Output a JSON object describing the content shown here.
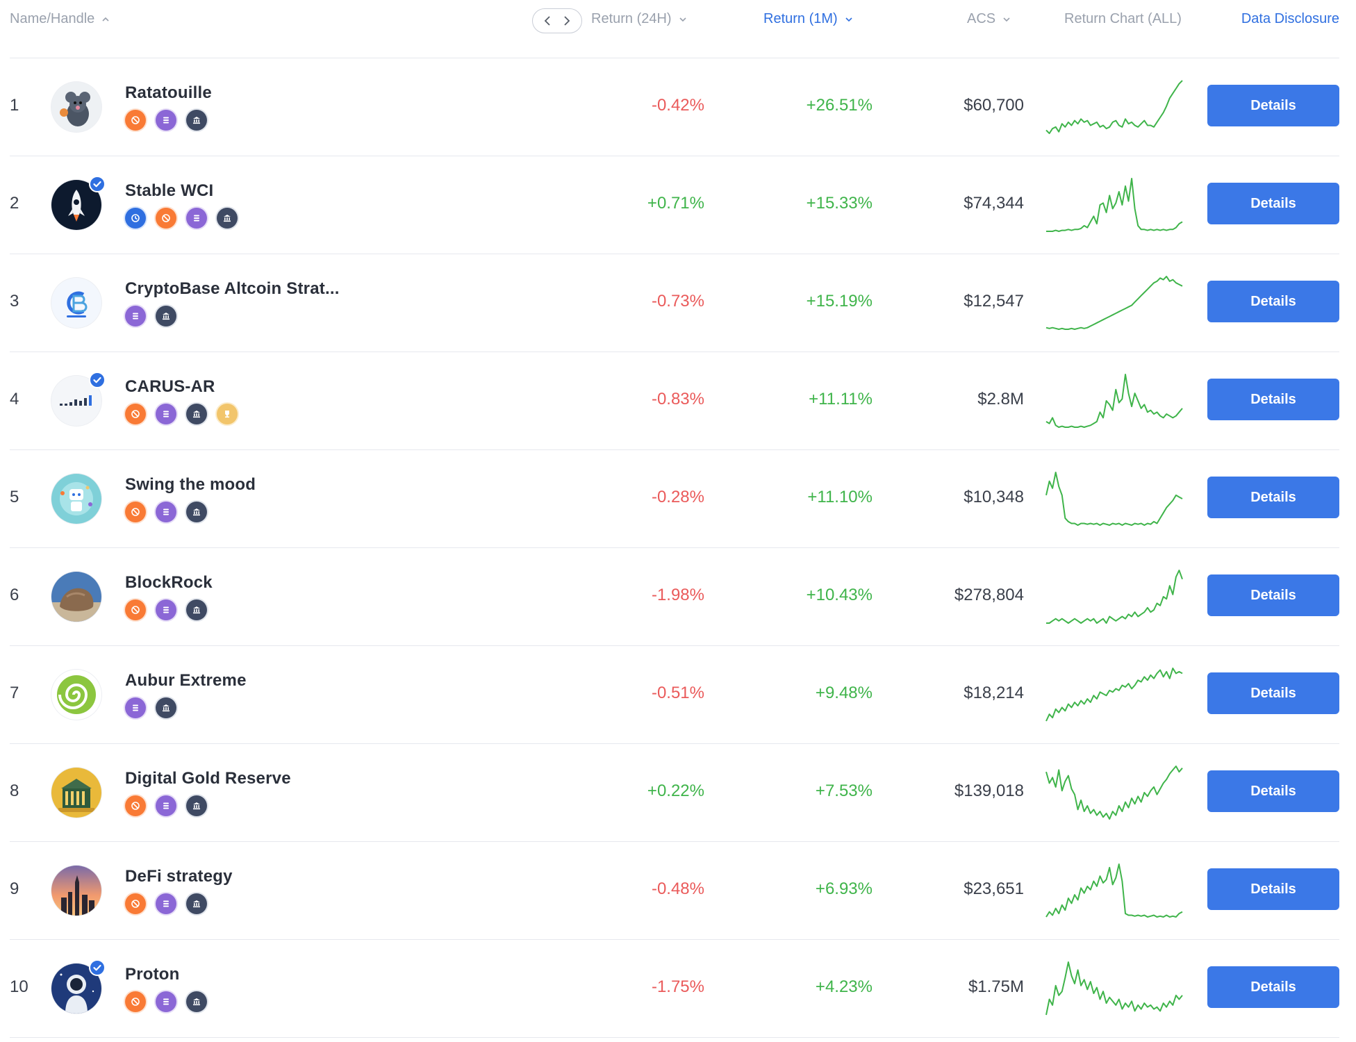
{
  "header": {
    "name_handle": "Name/Handle",
    "return_24h": "Return (24H)",
    "return_1m": "Return (1M)",
    "acs": "ACS",
    "return_chart": "Return Chart (ALL)",
    "data_disclosure": "Data Disclosure"
  },
  "details_label": "Details",
  "colors": {
    "negative": "#ea5a5a",
    "positive": "#3fb44a",
    "accent": "#3b78e7",
    "sparkline": "#3fb44a"
  },
  "rows": [
    {
      "rank": "1",
      "name": "Ratatouille",
      "verified": false,
      "badges": [
        "orange",
        "purple",
        "dark"
      ],
      "r24": "-0.42%",
      "r24_dir": "neg",
      "r1m": "+26.51%",
      "r1m_dir": "pos",
      "acs": "$60,700",
      "avatar": "rat",
      "spark": [
        62,
        66,
        60,
        58,
        64,
        54,
        58,
        52,
        56,
        50,
        54,
        48,
        52,
        50,
        56,
        54,
        52,
        58,
        56,
        60,
        58,
        52,
        50,
        56,
        58,
        48,
        54,
        52,
        56,
        58,
        54,
        50,
        56,
        56,
        58,
        52,
        46,
        40,
        32,
        22,
        16,
        10,
        4,
        0
      ]
    },
    {
      "rank": "2",
      "name": "Stable WCI",
      "verified": true,
      "badges": [
        "blue",
        "orange",
        "purple",
        "dark"
      ],
      "r24": "+0.71%",
      "r24_dir": "pos",
      "r1m": "+15.33%",
      "r1m_dir": "pos",
      "acs": "$74,344",
      "avatar": "rocket",
      "spark": [
        68,
        68,
        68,
        67,
        68,
        67,
        67,
        66,
        67,
        66,
        66,
        65,
        62,
        64,
        58,
        52,
        60,
        40,
        38,
        48,
        30,
        44,
        38,
        26,
        40,
        20,
        36,
        12,
        44,
        62,
        66,
        66,
        67,
        66,
        67,
        66,
        67,
        66,
        67,
        66,
        66,
        64,
        60,
        58
      ]
    },
    {
      "rank": "3",
      "name": "CryptoBase Altcoin Strat...",
      "verified": false,
      "badges": [
        "purple",
        "dark"
      ],
      "r24": "-0.73%",
      "r24_dir": "neg",
      "r1m": "+15.19%",
      "r1m_dir": "pos",
      "acs": "$12,547",
      "avatar": "cryptobase",
      "spark": [
        66,
        67,
        66,
        67,
        68,
        67,
        68,
        68,
        67,
        68,
        67,
        66,
        67,
        66,
        64,
        62,
        60,
        58,
        56,
        54,
        52,
        50,
        48,
        46,
        44,
        42,
        40,
        38,
        34,
        30,
        26,
        22,
        18,
        14,
        10,
        8,
        4,
        6,
        2,
        8,
        6,
        10,
        12,
        14
      ]
    },
    {
      "rank": "4",
      "name": "CARUS-AR",
      "verified": true,
      "badges": [
        "orange",
        "purple",
        "dark",
        "gold"
      ],
      "r24": "-0.83%",
      "r24_dir": "neg",
      "r1m": "+11.11%",
      "r1m_dir": "pos",
      "acs": "$2.8M",
      "avatar": "carus",
      "spark": [
        60,
        62,
        56,
        64,
        66,
        65,
        66,
        66,
        65,
        66,
        66,
        65,
        66,
        65,
        64,
        62,
        60,
        50,
        56,
        38,
        42,
        48,
        26,
        40,
        36,
        10,
        30,
        44,
        30,
        38,
        46,
        42,
        50,
        48,
        52,
        50,
        54,
        56,
        52,
        54,
        56,
        54,
        50,
        46
      ]
    },
    {
      "rank": "5",
      "name": "Swing the mood",
      "verified": false,
      "badges": [
        "orange",
        "purple",
        "dark"
      ],
      "r24": "-0.28%",
      "r24_dir": "neg",
      "r1m": "+11.10%",
      "r1m_dir": "pos",
      "acs": "$10,348",
      "avatar": "swing",
      "spark": [
        30,
        14,
        22,
        4,
        20,
        30,
        56,
        60,
        62,
        62,
        64,
        62,
        62,
        63,
        62,
        63,
        62,
        64,
        62,
        63,
        64,
        62,
        63,
        62,
        64,
        62,
        63,
        64,
        62,
        63,
        62,
        64,
        62,
        63,
        60,
        62,
        56,
        50,
        44,
        40,
        36,
        30,
        32,
        34
      ]
    },
    {
      "rank": "6",
      "name": "BlockRock",
      "verified": false,
      "badges": [
        "orange",
        "purple",
        "dark"
      ],
      "r24": "-1.98%",
      "r24_dir": "neg",
      "r1m": "+10.43%",
      "r1m_dir": "pos",
      "acs": "$278,804",
      "avatar": "rock",
      "spark": [
        62,
        62,
        60,
        58,
        60,
        58,
        60,
        62,
        60,
        58,
        60,
        62,
        60,
        58,
        60,
        58,
        62,
        60,
        58,
        62,
        56,
        58,
        60,
        58,
        56,
        58,
        54,
        56,
        52,
        56,
        54,
        52,
        48,
        52,
        50,
        44,
        46,
        38,
        40,
        28,
        36,
        20,
        14,
        22
      ]
    },
    {
      "rank": "7",
      "name": "Aubur Extreme",
      "verified": false,
      "badges": [
        "purple",
        "dark"
      ],
      "r24": "-0.51%",
      "r24_dir": "neg",
      "r1m": "+9.48%",
      "r1m_dir": "pos",
      "acs": "$18,214",
      "avatar": "spiral",
      "spark": [
        66,
        58,
        62,
        52,
        56,
        50,
        54,
        46,
        50,
        44,
        48,
        42,
        46,
        40,
        44,
        36,
        40,
        32,
        34,
        36,
        30,
        32,
        28,
        30,
        24,
        26,
        22,
        28,
        24,
        18,
        20,
        14,
        18,
        12,
        16,
        10,
        6,
        14,
        8,
        16,
        4,
        10,
        8,
        10
      ]
    },
    {
      "rank": "8",
      "name": "Digital Gold Reserve",
      "verified": false,
      "badges": [
        "orange",
        "purple",
        "dark"
      ],
      "r24": "+0.22%",
      "r24_dir": "pos",
      "r1m": "+7.53%",
      "r1m_dir": "pos",
      "acs": "$139,018",
      "avatar": "gold",
      "spark": [
        10,
        22,
        16,
        26,
        8,
        30,
        20,
        14,
        28,
        34,
        50,
        40,
        52,
        46,
        54,
        50,
        56,
        52,
        58,
        54,
        60,
        52,
        56,
        46,
        52,
        42,
        48,
        38,
        44,
        36,
        42,
        32,
        36,
        30,
        26,
        34,
        28,
        22,
        18,
        12,
        8,
        4,
        10,
        6
      ]
    },
    {
      "rank": "9",
      "name": "DeFi strategy",
      "verified": false,
      "badges": [
        "orange",
        "purple",
        "dark"
      ],
      "r24": "-0.48%",
      "r24_dir": "neg",
      "r1m": "+6.93%",
      "r1m_dir": "pos",
      "acs": "$23,651",
      "avatar": "city",
      "spark": [
        66,
        60,
        64,
        56,
        62,
        52,
        58,
        44,
        50,
        40,
        46,
        32,
        38,
        30,
        34,
        24,
        30,
        18,
        26,
        22,
        8,
        28,
        20,
        4,
        24,
        62,
        64,
        64,
        65,
        64,
        65,
        64,
        66,
        65,
        64,
        66,
        65,
        66,
        64,
        66,
        65,
        66,
        62,
        60
      ]
    },
    {
      "rank": "10",
      "name": "Proton",
      "verified": true,
      "badges": [
        "orange",
        "purple",
        "dark"
      ],
      "r24": "-1.75%",
      "r24_dir": "neg",
      "r1m": "+4.23%",
      "r1m_dir": "pos",
      "acs": "$1.75M",
      "avatar": "astronaut",
      "spark": [
        60,
        44,
        50,
        30,
        40,
        36,
        22,
        6,
        20,
        28,
        14,
        30,
        24,
        34,
        26,
        38,
        32,
        44,
        36,
        48,
        42,
        46,
        50,
        44,
        54,
        48,
        52,
        46,
        56,
        50,
        54,
        48,
        52,
        50,
        54,
        52,
        56,
        48,
        52,
        46,
        50,
        40,
        44,
        40
      ]
    }
  ]
}
